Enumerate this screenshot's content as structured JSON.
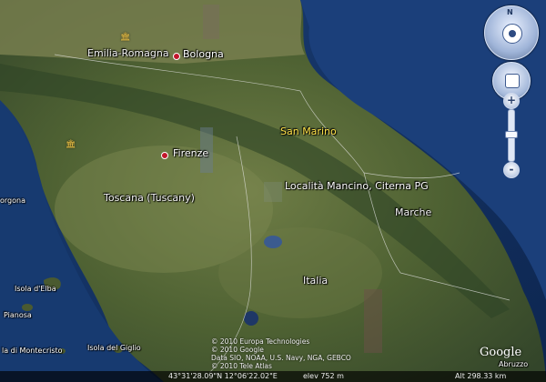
{
  "map": {
    "places": {
      "emilia": "Emilia-Romagna",
      "bologna": "Bologna",
      "san_marino": "San Marino",
      "firenze": "Firenze",
      "localita": "Località Mancino, Citerna PG",
      "marche": "Marche",
      "toscana": "Toscana (Tuscany)",
      "gorgona": "orgona",
      "isola_elba": "Isola d'Elba",
      "pianosa": "Pianosa",
      "italia": "Italia",
      "montecristo": "la di Montecristo",
      "giglio": "Isola del Giglio",
      "abruzzo": "Abruzzo"
    },
    "credits": [
      "© 2010 Europa Technologies",
      "© 2010 Google",
      "Data SIO, NOAA, U.S. Navy, NGA, GEBCO",
      "© 2010 Tele Atlas"
    ],
    "logo": "Google",
    "status": {
      "coords": "43°31'28.09\"N   12°06'22.02\"E",
      "elev": "elev  752 m",
      "alt": "Alt  298.33 km"
    },
    "controls": {
      "compass_n": "N",
      "zoom_in": "+",
      "zoom_out": "-"
    }
  }
}
